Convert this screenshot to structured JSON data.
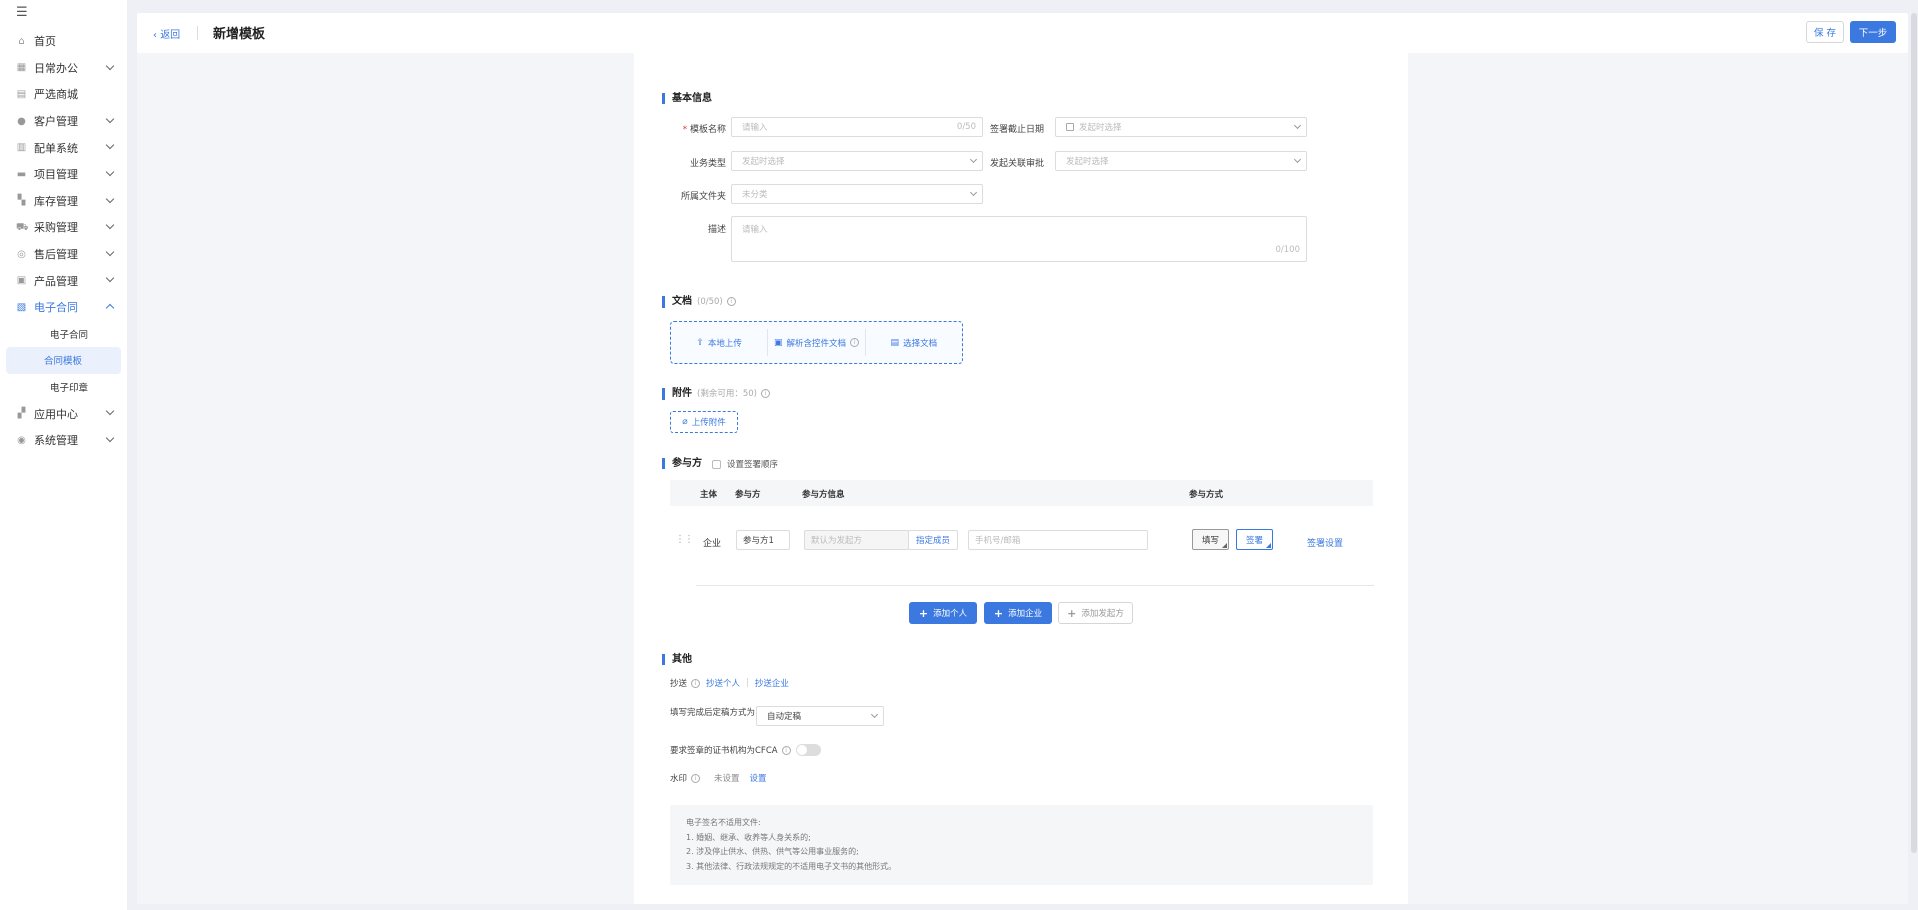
{
  "sidebar": {
    "items": [
      {
        "label": "首页",
        "icon": "home-icon",
        "expandable": false
      },
      {
        "label": "日常办公",
        "icon": "briefcase-icon",
        "expandable": true
      },
      {
        "label": "严选商城",
        "icon": "store-icon",
        "expandable": false
      },
      {
        "label": "客户管理",
        "icon": "users-icon",
        "expandable": true
      },
      {
        "label": "配单系统",
        "icon": "document-icon",
        "expandable": true
      },
      {
        "label": "项目管理",
        "icon": "folder-icon",
        "expandable": true
      },
      {
        "label": "库存管理",
        "icon": "boxes-icon",
        "expandable": true
      },
      {
        "label": "采购管理",
        "icon": "cart-icon",
        "expandable": true
      },
      {
        "label": "售后管理",
        "icon": "headset-icon",
        "expandable": true
      },
      {
        "label": "产品管理",
        "icon": "product-icon",
        "expandable": true
      },
      {
        "label": "电子合同",
        "icon": "contract-icon",
        "expandable": true,
        "active": true
      },
      {
        "label": "应用中心",
        "icon": "apps-icon",
        "expandable": true
      },
      {
        "label": "系统管理",
        "icon": "settings-icon",
        "expandable": true
      }
    ],
    "subitems": [
      "电子合同",
      "合同模板",
      "电子印章"
    ]
  },
  "header": {
    "back": "返回",
    "title": "新增模板",
    "save": "保 存",
    "next": "下一步"
  },
  "basic": {
    "title": "基本信息",
    "name_label": "模板名称",
    "name_placeholder": "请输入",
    "name_count": "0/50",
    "deadline_label": "签署截止日期",
    "deadline_value": "发起时选择",
    "biz_type_label": "业务类型",
    "biz_type_value": "发起时选择",
    "approval_label": "发起关联审批",
    "approval_value": "发起时选择",
    "folder_label": "所属文件夹",
    "folder_value": "未分类",
    "desc_label": "描述",
    "desc_placeholder": "请输入",
    "desc_count": "0/100"
  },
  "docs": {
    "title": "文档",
    "hint": "(0/50)",
    "local_upload": "本地上传",
    "parse_control": "解析含控件文档",
    "choose_doc": "选择文档"
  },
  "attachments": {
    "title": "附件",
    "hint": "(剩余可用：50)",
    "upload": "上传附件"
  },
  "participants": {
    "title": "参与方",
    "order_checkbox": "设置签署顺序",
    "headers": {
      "subject": "主体",
      "party": "参与方",
      "party_info": "参与方信息",
      "mode": "参与方式"
    },
    "row": {
      "subject": "企业",
      "party": "参与方1",
      "default_initiator": "默认为发起方",
      "assign_member": "指定成员",
      "phone_placeholder": "手机号/邮箱",
      "fill": "填写",
      "sign": "签署",
      "sign_settings": "签署设置"
    },
    "add_person": "添加个人",
    "add_company": "添加企业",
    "add_initiator": "添加发起方"
  },
  "other": {
    "title": "其他",
    "cc_label": "抄送",
    "cc_person": "抄送个人",
    "cc_company": "抄送企业",
    "finalize_label": "填写完成后定稿方式为",
    "finalize_value": "自动定稿",
    "cfca_label": "要求签章的证书机构为CFCA",
    "watermark_label": "水印",
    "watermark_status": "未设置",
    "watermark_set": "设置"
  },
  "notice": [
    "电子签名不适用文件:",
    "1. 婚姻、继承、收养等人身关系的;",
    "2. 涉及停止供水、供热、供气等公用事业服务的;",
    "3. 其他法律、行政法规规定的不适用电子文书的其他形式。"
  ],
  "colors": {
    "accent": "#3b78e0",
    "background": "#eef0f5"
  }
}
